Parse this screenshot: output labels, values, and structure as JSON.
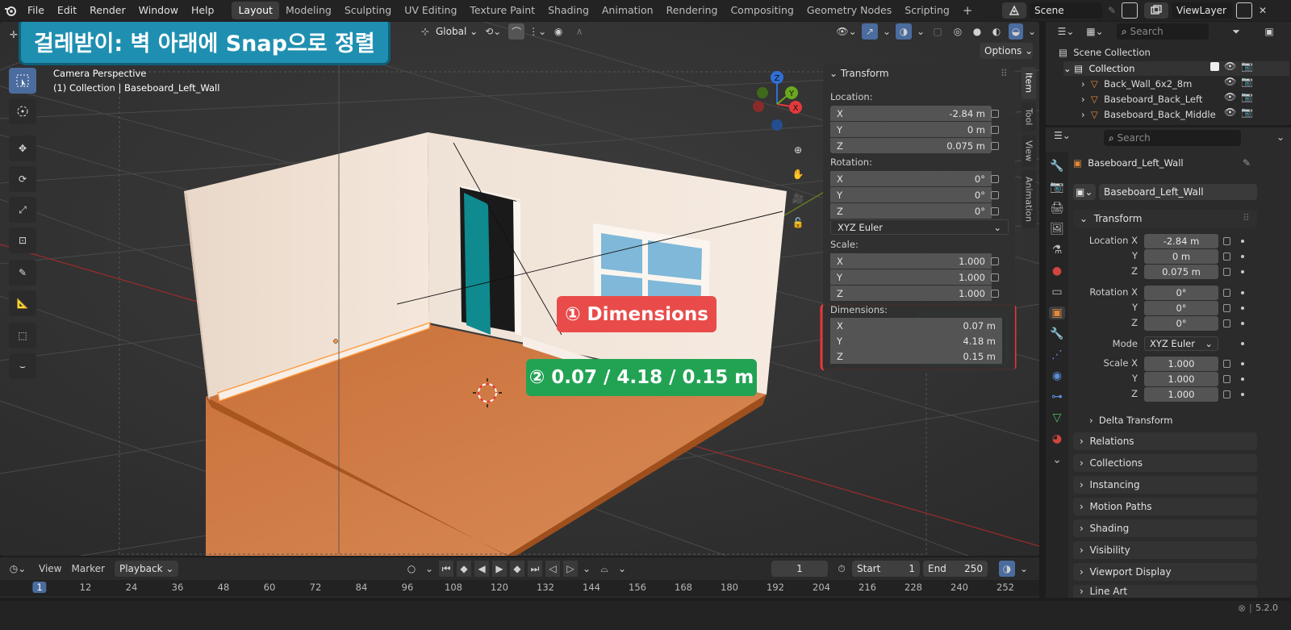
{
  "menu": [
    "File",
    "Edit",
    "Render",
    "Window",
    "Help"
  ],
  "workspaces": [
    "Layout",
    "Modeling",
    "Sculpting",
    "UV Editing",
    "Texture Paint",
    "Shading",
    "Animation",
    "Rendering",
    "Compositing",
    "Geometry Nodes",
    "Scripting"
  ],
  "scene": "Scene",
  "view_layer": "ViewLayer",
  "viewport": {
    "orientation": "Global",
    "options": "Options",
    "camera_label": "Camera Perspective",
    "object_label": "(1) Collection | Baseboard_Left_Wall",
    "banner": "걸레받이: 벽 아래에 Snap으로 정렬",
    "callout1": "① Dimensions",
    "callout2": "② 0.07 / 4.18 / 0.15 m"
  },
  "npanel": {
    "header": "Transform",
    "location_label": "Location:",
    "location": [
      {
        "a": "X",
        "v": "-2.84 m"
      },
      {
        "a": "Y",
        "v": "0 m"
      },
      {
        "a": "Z",
        "v": "0.075 m"
      }
    ],
    "rotation_label": "Rotation:",
    "rotation": [
      {
        "a": "X",
        "v": "0°"
      },
      {
        "a": "Y",
        "v": "0°"
      },
      {
        "a": "Z",
        "v": "0°"
      }
    ],
    "rotation_mode": "XYZ Euler",
    "scale_label": "Scale:",
    "scale": [
      {
        "a": "X",
        "v": "1.000"
      },
      {
        "a": "Y",
        "v": "1.000"
      },
      {
        "a": "Z",
        "v": "1.000"
      }
    ],
    "dimensions_label": "Dimensions:",
    "dimensions": [
      {
        "a": "X",
        "v": "0.07 m"
      },
      {
        "a": "Y",
        "v": "4.18 m"
      },
      {
        "a": "Z",
        "v": "0.15 m"
      }
    ],
    "tabs": [
      "Item",
      "Tool",
      "View",
      "Animation"
    ]
  },
  "outliner": {
    "search_placeholder": "Search",
    "root": "Scene Collection",
    "collection": "Collection",
    "items": [
      "Back_Wall_6x2_8m",
      "Baseboard_Back_Left",
      "Baseboard_Back_Middle"
    ]
  },
  "properties": {
    "search_placeholder": "Search",
    "object_name": "Baseboard_Left_Wall",
    "object_field": "Baseboard_Left_Wall",
    "transform": "Transform",
    "location_x_label": "Location X",
    "location": [
      "-2.84 m",
      "0 m",
      "0.075 m"
    ],
    "rotation_x_label": "Rotation X",
    "rotation": [
      "0°",
      "0°",
      "0°"
    ],
    "mode_label": "Mode",
    "mode": "XYZ Euler",
    "scale_x_label": "Scale X",
    "scale": [
      "1.000",
      "1.000",
      "1.000"
    ],
    "y_label": "Y",
    "z_label": "Z",
    "delta": "Delta Transform",
    "sections": [
      "Relations",
      "Collections",
      "Instancing",
      "Motion Paths",
      "Shading",
      "Visibility",
      "Viewport Display",
      "Line Art"
    ]
  },
  "timeline": {
    "view": "View",
    "marker": "Marker",
    "playback": "Playback",
    "current_frame": "1",
    "start_label": "Start",
    "start": "1",
    "end_label": "End",
    "end": "250",
    "ticks": [
      "1",
      "12",
      "24",
      "36",
      "48",
      "60",
      "72",
      "84",
      "96",
      "108",
      "120",
      "132",
      "144",
      "156",
      "168",
      "180",
      "192",
      "204",
      "216",
      "228",
      "240",
      "252"
    ]
  },
  "status": {
    "version": "5.2.0"
  },
  "colors": {
    "accent": "#4b6c9e",
    "red_box": "#e5383b",
    "green_box": "#1f9d4d",
    "callout_red": "#e94b4b",
    "callout_green": "#22a354",
    "banner": "#1f8fb1"
  }
}
